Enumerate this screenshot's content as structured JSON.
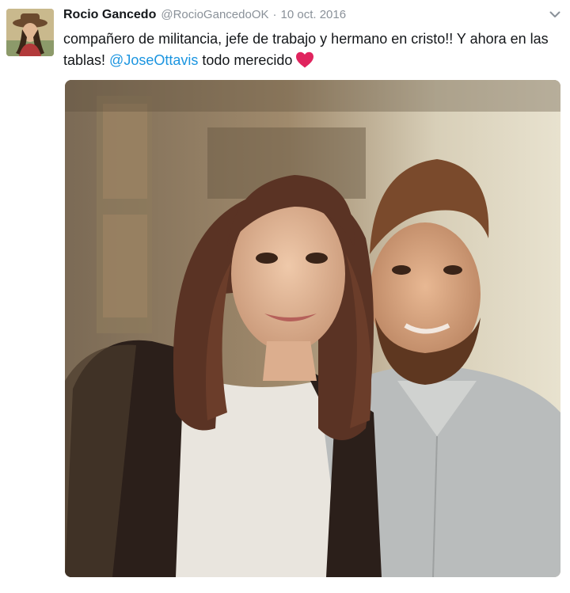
{
  "tweet": {
    "author_name": "Rocio Gancedo",
    "author_handle": "@RocioGancedoOK",
    "separator": "·",
    "timestamp": "10 oct. 2016",
    "text_part1": "compañero de militancia, jefe de trabajo y hermano en cristo!! Y ahora en las tablas! ",
    "mention": "@JoseOttavis",
    "text_part2": " todo merecido",
    "heart_icon": "heart-icon",
    "caret_icon": "chevron-down-icon",
    "mention_color": "#1b95e0",
    "heart_color": "#e0245e"
  }
}
